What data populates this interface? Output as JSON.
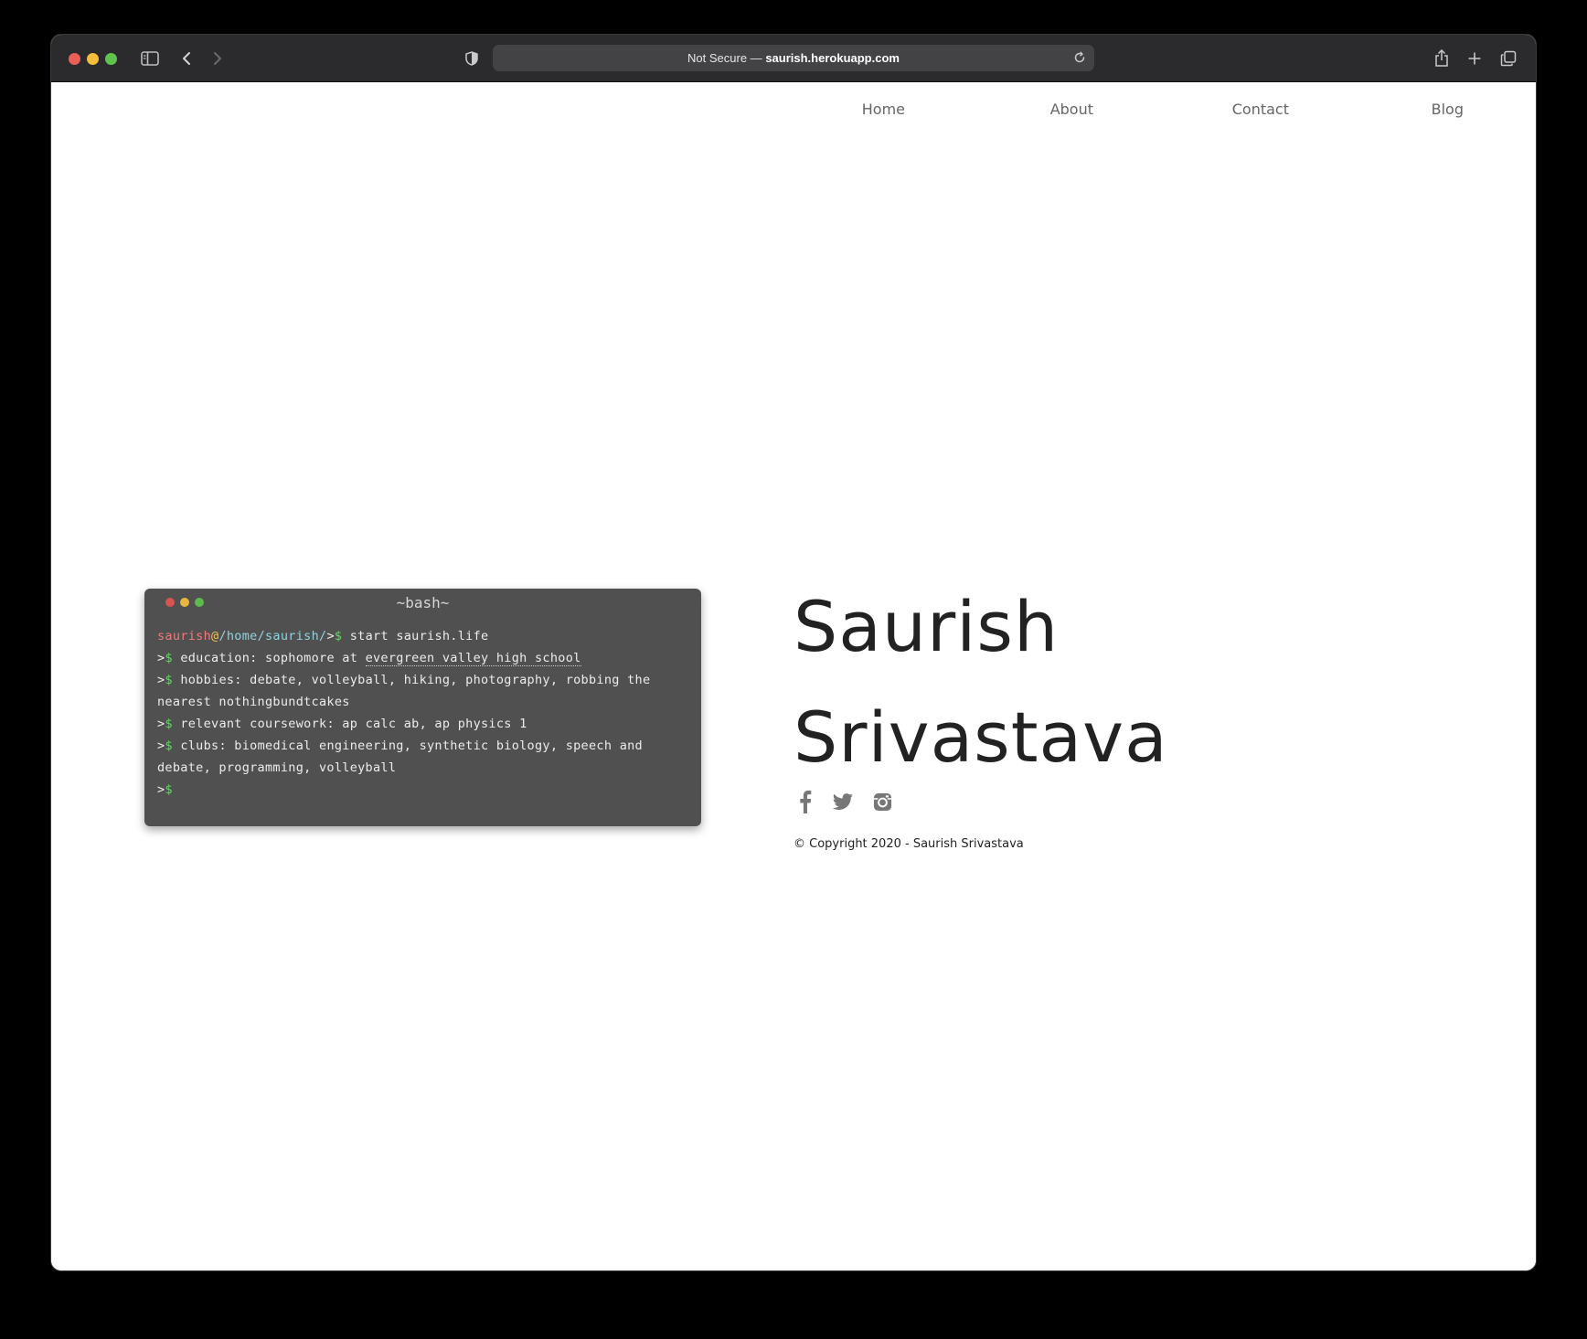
{
  "browser": {
    "address": {
      "security_label": "Not Secure —",
      "host": "saurish.herokuapp.com"
    },
    "icons": {
      "close": "close-dot",
      "minimize": "minimize-dot",
      "zoom": "zoom-dot",
      "sidebar": "sidebar-icon",
      "back": "back-arrow-icon",
      "forward": "forward-arrow-icon",
      "privacy": "shield-icon",
      "reload": "reload-icon",
      "share": "share-icon",
      "new_tab": "plus-icon",
      "tabs": "tab-overview-icon"
    },
    "colors": {
      "close": "#ec5f57",
      "minimize": "#f4bd3b",
      "zoom": "#5fc44c",
      "toolbar": "#2b2b2d",
      "address_bar": "#434345"
    }
  },
  "nav": {
    "items": [
      "Home",
      "About",
      "Contact",
      "Blog"
    ]
  },
  "terminal": {
    "title": "~bash~",
    "user": "saurish",
    "at": "@",
    "path": "/home/saurish/",
    "prompt_gt": ">",
    "prompt_dollar": "$",
    "command": "start saurish.life",
    "lines": [
      {
        "prefix": "education: sophomore at ",
        "link": "evergreen valley high school"
      },
      {
        "text": "hobbies: debate, volleyball, hiking, photography, robbing the nearest nothingbundtcakes"
      },
      {
        "text": "relevant coursework: ap calc ab, ap physics 1"
      },
      {
        "text": "clubs: biomedical engineering, synthetic biology, speech and debate, programming, volleyball"
      }
    ],
    "colors": {
      "background": "#505050",
      "user": "#ef7b7b",
      "at": "#f1c34f",
      "path": "#8fd3df",
      "prompt": "#6fd06f"
    }
  },
  "profile": {
    "first_name": "Saurish",
    "last_name": "Srivastava",
    "socials": [
      "facebook-icon",
      "twitter-icon",
      "instagram-icon"
    ],
    "copyright": "© Copyright 2020 - Saurish Srivastava"
  }
}
